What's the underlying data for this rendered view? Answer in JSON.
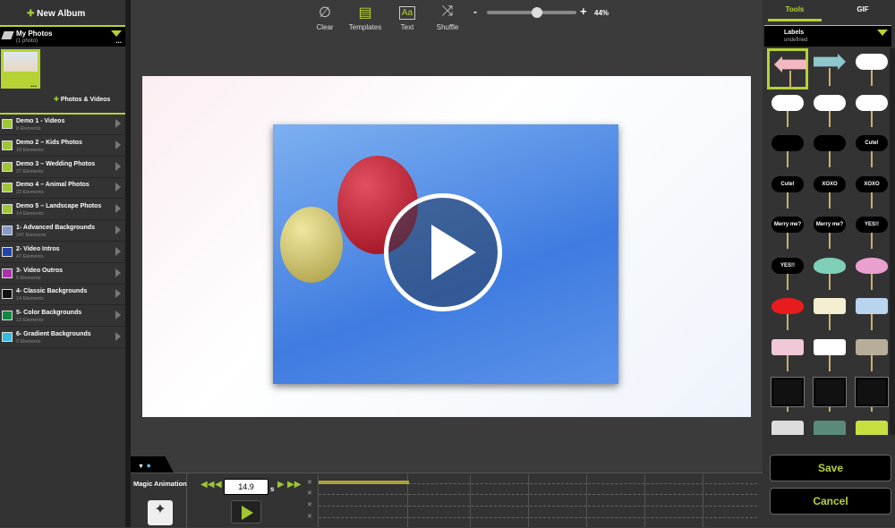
{
  "sidebar": {
    "new_album": "New Album",
    "album": {
      "title": "My Photos",
      "subtitle": "(1 photo)",
      "more": "..."
    },
    "thumb_more": "...",
    "add_label": "Photos & Videos",
    "items": [
      {
        "title": "Demo 1 - Videos",
        "count": "8 Elements",
        "icon": "demo-check-icon",
        "color": "#9fc635"
      },
      {
        "title": "Demo 2 – Kids Photos",
        "count": "18 Elements",
        "icon": "demo-check-icon",
        "color": "#9fc635"
      },
      {
        "title": "Demo 3 – Wedding Photos",
        "count": "27 Elements",
        "icon": "demo-check-icon",
        "color": "#9fc635"
      },
      {
        "title": "Demo 4 – Animal Photos",
        "count": "22 Elements",
        "icon": "demo-check-icon",
        "color": "#9fc635"
      },
      {
        "title": "Demo 5 – Landscape Photos",
        "count": "14 Elements",
        "icon": "demo-check-icon",
        "color": "#9fc635"
      },
      {
        "title": "1- Advanced Backgrounds",
        "count": "247 Elements",
        "icon": "backgrounds-stack-icon",
        "color": "#8899cc"
      },
      {
        "title": "2- Video Intros",
        "count": "47 Elements",
        "icon": "video-intro-icon",
        "color": "#2244aa"
      },
      {
        "title": "3- Video Outros",
        "count": "6 Elements",
        "icon": "video-outro-icon",
        "color": "#aa33aa"
      },
      {
        "title": "4- Classic Backgrounds",
        "count": "14 Elements",
        "icon": "classic-bg-icon",
        "color": "#111111"
      },
      {
        "title": "5- Color Backgrounds",
        "count": "13 Elements",
        "icon": "color-bg-icon",
        "color": "#118844"
      },
      {
        "title": "6- Gradient Backgrounds",
        "count": "9 Elements",
        "icon": "gradient-bg-icon",
        "color": "#33bbdd"
      }
    ]
  },
  "toolbar": {
    "clear": "Clear",
    "templates": "Templates",
    "text": "Text",
    "text_glyph": "Aa",
    "shuffle": "Shuffle",
    "zoom_minus": "-",
    "zoom_plus": "+",
    "zoom": "44%",
    "zoom_fraction": 0.44
  },
  "right": {
    "tabs": [
      "Tools",
      "GIF"
    ],
    "active_tab": "Tools",
    "category": {
      "title": "Labels",
      "subtitle": "undefined"
    },
    "stickers": [
      {
        "shape": "arrow-left",
        "color": "#f4b8c0",
        "text": ""
      },
      {
        "shape": "arrow-right",
        "color": "#8cc8cc",
        "text": ""
      },
      {
        "shape": "cloud",
        "color": "#ffffff",
        "text": ""
      },
      {
        "shape": "cloud",
        "color": "#ffffff",
        "text": ""
      },
      {
        "shape": "bubble",
        "color": "#ffffff",
        "text": ""
      },
      {
        "shape": "bubble",
        "color": "#ffffff",
        "text": ""
      },
      {
        "shape": "cloud",
        "color": "#000000",
        "text": ""
      },
      {
        "shape": "bubble",
        "color": "#000000",
        "text": ""
      },
      {
        "shape": "cloud",
        "color": "#000000",
        "text": "Cute!"
      },
      {
        "shape": "cloud",
        "color": "#000000",
        "text": "Cute!"
      },
      {
        "shape": "cloud",
        "color": "#000000",
        "text": "XOXO"
      },
      {
        "shape": "cloud",
        "color": "#000000",
        "text": "XOXO"
      },
      {
        "shape": "cloud",
        "color": "#000000",
        "text": "Merry me?"
      },
      {
        "shape": "cloud",
        "color": "#000000",
        "text": "Merry me?"
      },
      {
        "shape": "cloud",
        "color": "#000000",
        "text": "YES!!"
      },
      {
        "shape": "cloud",
        "color": "#000000",
        "text": "YES!!"
      },
      {
        "shape": "heart",
        "color": "#7fcfb8",
        "text": ""
      },
      {
        "shape": "heart",
        "color": "#e9a0cf",
        "text": ""
      },
      {
        "shape": "heart",
        "color": "#e81c1c",
        "text": ""
      },
      {
        "shape": "rect",
        "color": "#f3efd0",
        "text": ""
      },
      {
        "shape": "rect",
        "color": "#b8d4ee",
        "text": ""
      },
      {
        "shape": "rect",
        "color": "#f0c8d8",
        "text": ""
      },
      {
        "shape": "rect",
        "color": "#ffffff",
        "text": ""
      },
      {
        "shape": "rect",
        "color": "#b8ad98",
        "text": ""
      },
      {
        "shape": "frame",
        "color": "#111111",
        "text": ""
      },
      {
        "shape": "frame",
        "color": "#111111",
        "text": ""
      },
      {
        "shape": "frame",
        "color": "#111111",
        "text": ""
      },
      {
        "shape": "rect",
        "color": "#dddddd",
        "text": ""
      },
      {
        "shape": "rect",
        "color": "#5a8a7a",
        "text": ""
      },
      {
        "shape": "rect",
        "color": "#c8e040",
        "text": ""
      }
    ],
    "save": "Save",
    "cancel": "Cancel"
  },
  "timeline": {
    "magic_label": "Magic Animation",
    "time": "14.9",
    "unit": "s",
    "clip_progress": 0.3
  },
  "colors": {
    "accent": "#b5d334"
  }
}
